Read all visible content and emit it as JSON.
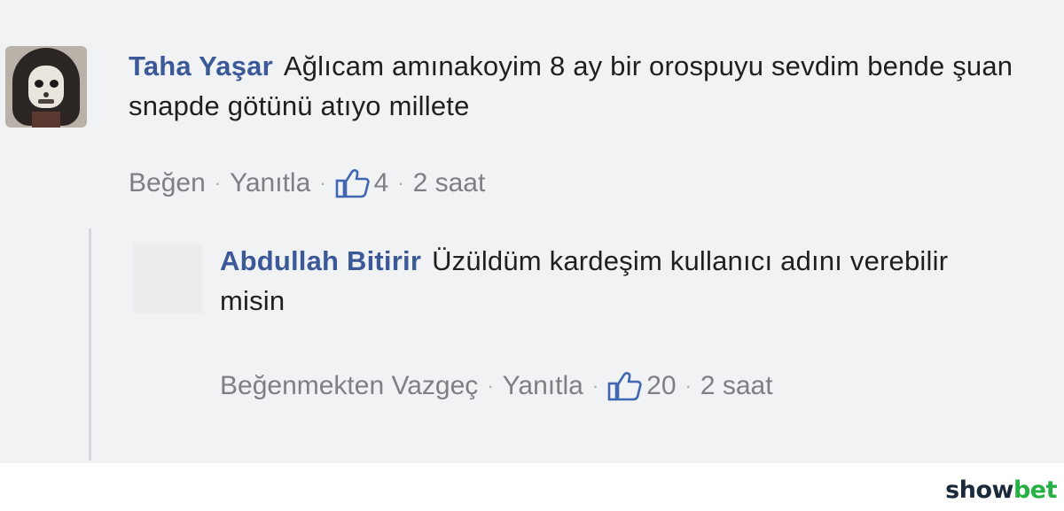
{
  "comments": [
    {
      "author": "Taha Yaşar",
      "text": "Ağlıcam amınakoyim 8 ay bir orospuyu sevdim bende şuan snapde götünü atıyo millete",
      "actions": {
        "like": "Beğen",
        "reply": "Yanıtla"
      },
      "likes": "4",
      "time": "2 saat"
    },
    {
      "author": "Abdullah Bitirir",
      "text": "Üzüldüm kardeşim kullanıcı adını verebilir misin",
      "actions": {
        "like": "Beğenmekten Vazgeç",
        "reply": "Yanıtla"
      },
      "likes": "20",
      "time": "2 saat"
    }
  ],
  "watermark": {
    "part1": "show",
    "part2": "bet"
  },
  "colors": {
    "author": "#3b5998",
    "meta": "#7d7f84",
    "watermark_dark": "#1b2a3a",
    "watermark_green": "#25b043"
  },
  "icons": {
    "avatar": "user-avatar-icon",
    "like": "thumbs-up-icon"
  }
}
